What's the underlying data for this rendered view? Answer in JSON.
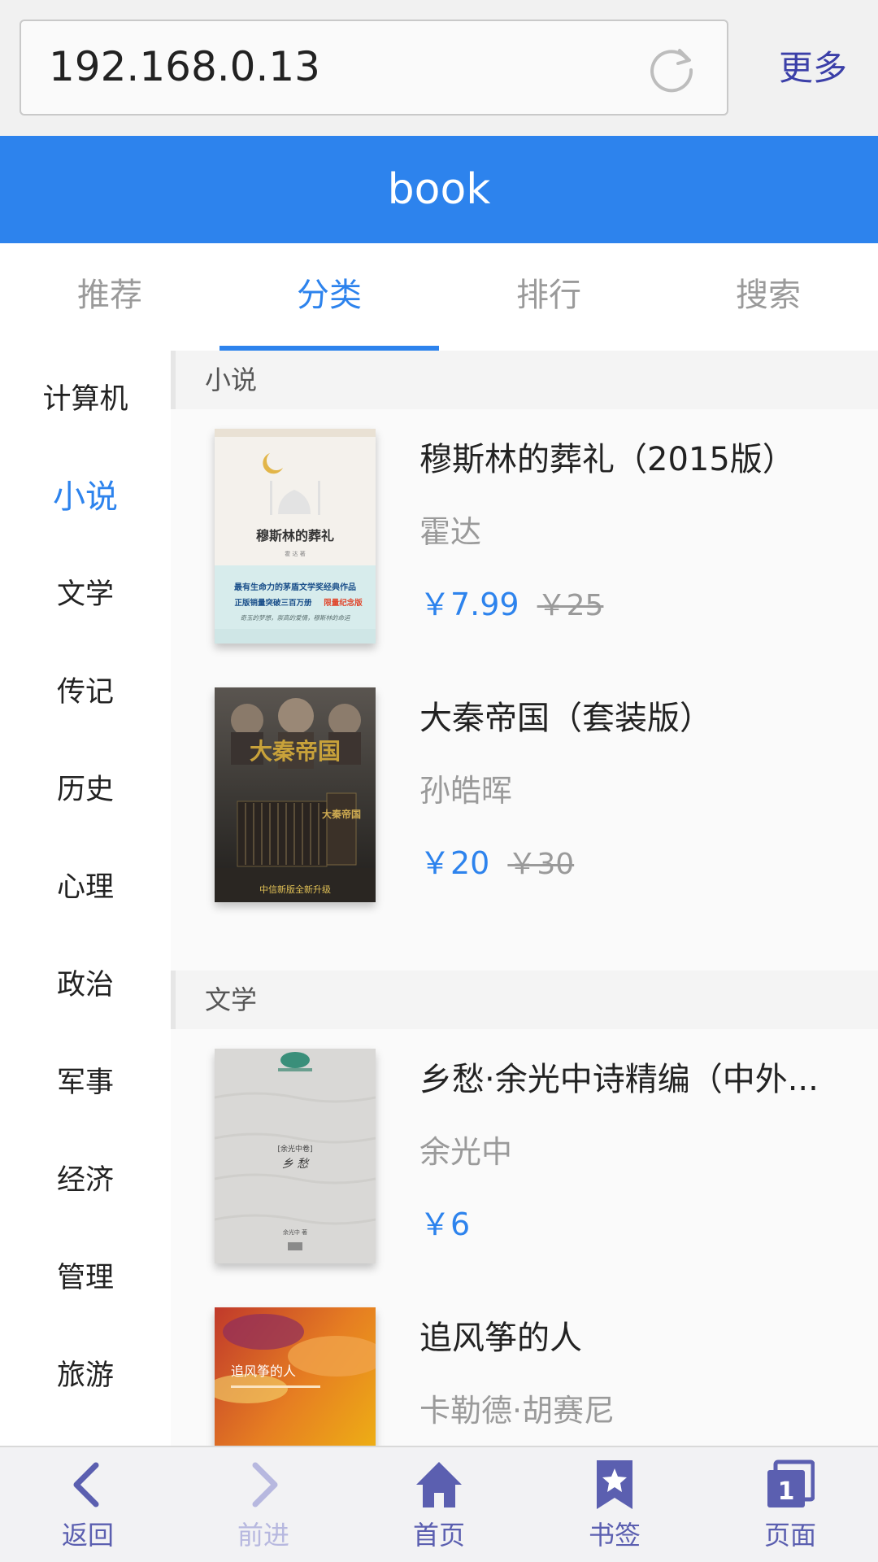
{
  "browser": {
    "url": "192.168.0.13",
    "more_label": "更多"
  },
  "header": {
    "title": "book"
  },
  "tabs": [
    {
      "label": "推荐",
      "active": false
    },
    {
      "label": "分类",
      "active": true
    },
    {
      "label": "排行",
      "active": false
    },
    {
      "label": "搜索",
      "active": false
    }
  ],
  "sidebar": {
    "items": [
      {
        "label": "计算机"
      },
      {
        "label": "小说",
        "active": true
      },
      {
        "label": "文学"
      },
      {
        "label": "传记"
      },
      {
        "label": "历史"
      },
      {
        "label": "心理"
      },
      {
        "label": "政治"
      },
      {
        "label": "军事"
      },
      {
        "label": "经济"
      },
      {
        "label": "管理"
      },
      {
        "label": "旅游"
      }
    ]
  },
  "sections": [
    {
      "title": "小说",
      "books": [
        {
          "title": "穆斯林的葬礼（2015版）",
          "author": "霍达",
          "price": "￥7.99",
          "original_price": "￥25",
          "cover": {
            "title": "穆斯林的葬礼",
            "author": "霍 达 著",
            "line1": "最有生命力的茅盾文学奖经典作品",
            "line2a": "正版销量突破三百万册",
            "line2b": "限量纪念版",
            "line3": "奇玉的梦想，崇高的爱情，穆斯林的命运"
          }
        },
        {
          "title": "大秦帝国（套装版）",
          "author": "孙皓晖",
          "price": "￥20",
          "original_price": "￥30",
          "cover": {
            "title": "大秦帝国",
            "box_text": "大秦帝国",
            "footer": "中信新版全新升级"
          }
        }
      ]
    },
    {
      "title": "文学",
      "books": [
        {
          "title": "乡愁·余光中诗精编（中外...",
          "author": "余光中",
          "price": "￥6",
          "original_price": "",
          "cover": {
            "volume": "[余光中卷]",
            "title": "乡 愁",
            "author": "余光中 著"
          }
        },
        {
          "title": "追风筝的人",
          "author": "卡勒德·胡赛尼",
          "price": "",
          "original_price": "",
          "cover": {
            "title": "追风筝的人"
          }
        }
      ]
    }
  ],
  "bottom_nav": [
    {
      "label": "返回",
      "icon": "chevron-left-icon",
      "enabled": true
    },
    {
      "label": "前进",
      "icon": "chevron-right-icon",
      "enabled": false
    },
    {
      "label": "首页",
      "icon": "home-icon",
      "enabled": true
    },
    {
      "label": "书签",
      "icon": "bookmark-star-icon",
      "enabled": true
    },
    {
      "label": "页面",
      "icon": "pages-icon",
      "enabled": true,
      "count": "1"
    }
  ],
  "colors": {
    "accent": "#2d83ed",
    "nav_icon": "#5b5fb0",
    "nav_icon_disabled": "#b7b8df"
  }
}
